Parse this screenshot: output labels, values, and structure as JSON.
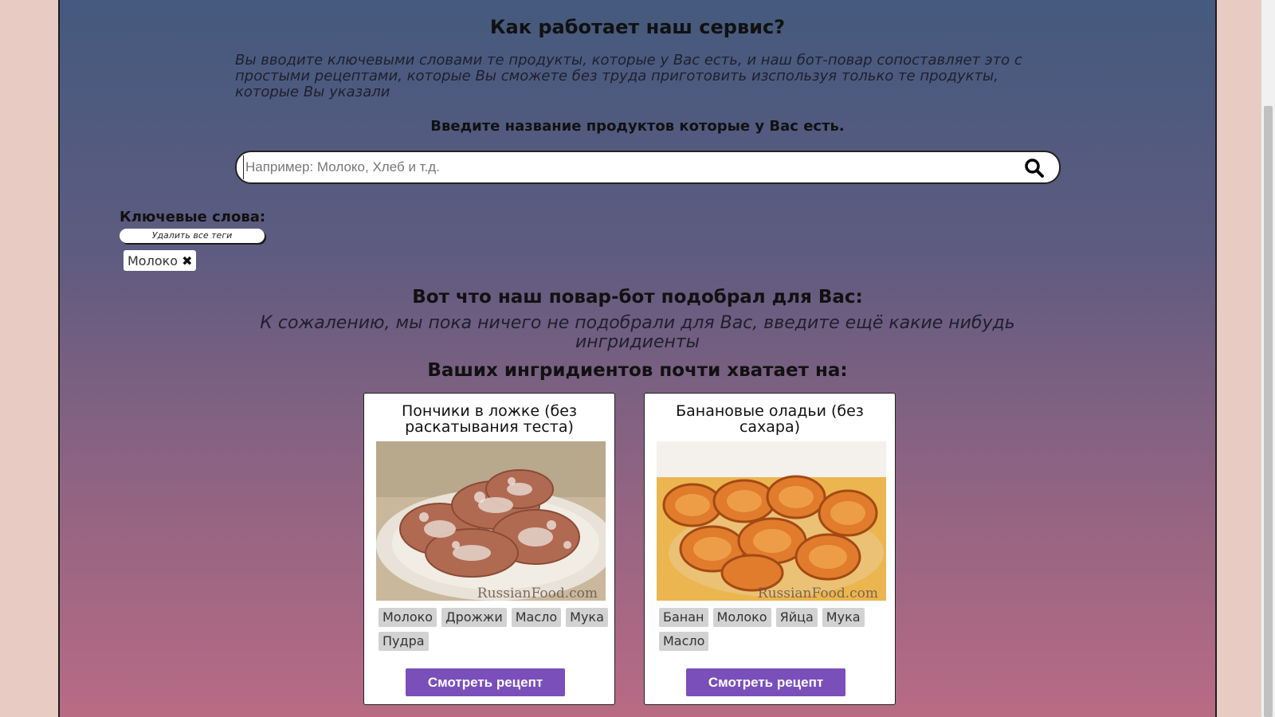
{
  "header": {
    "title": "Как работает наш сервис?",
    "intro": "Вы вводите ключевыми словами те продукты, которые у Вас есть, и наш бот-повар сопоставляет это с простыми рецептами, которые Вы сможете без труда приготовить изспользуя только те продукты, которые Вы указали"
  },
  "search": {
    "prompt": "Введите название продуктов которые у Вас есть.",
    "placeholder": "Например: Молоко, Хлеб и т.д.",
    "value": "",
    "icon": "search-icon"
  },
  "keywords": {
    "label": "Ключевые слова:",
    "clear_label": "Удалить все теги",
    "tags": [
      "Молоко"
    ],
    "remove_icon": "close-icon"
  },
  "results": {
    "title": "Вот что наш повар-бот подобрал для Вас:",
    "empty_message": "К сожалению, мы пока ничего не подобрали для Вас, введите ещё какие нибудь ингридиенты",
    "almost_title": "Ваших ингридиентов почти хватает на:"
  },
  "cards": [
    {
      "title": "Пончики в ложке (без раскатывания теста)",
      "image_watermark": "RussianFood.com",
      "ingredients": [
        "Молоко",
        "Дрожжи",
        "Масло",
        "Мука",
        "Пудра"
      ],
      "button_label": "Смотреть рецепт"
    },
    {
      "title": "Банановые оладьи (без сахара)",
      "image_watermark": "RussianFood.com",
      "ingredients": [
        "Банан",
        "Молоко",
        "Яйца",
        "Мука",
        "Масло"
      ],
      "button_label": "Смотреть рецепт"
    }
  ],
  "colors": {
    "accent": "#7a4fba",
    "chip": "#d2d2d2"
  }
}
